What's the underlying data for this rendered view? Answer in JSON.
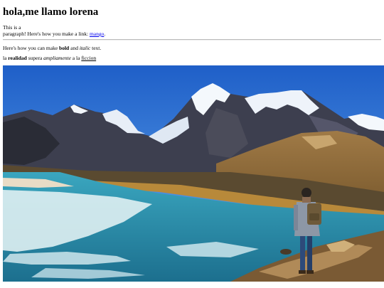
{
  "heading": "hola,me llamo lorena",
  "para1": {
    "line1": "This is a",
    "line2_text": "paragraph! Here's how you make a link: ",
    "link_text": "mango",
    "line2_end": "."
  },
  "para2": {
    "pre": "Here's how you can make ",
    "bold": "bold",
    "mid": " and ",
    "italic": "italic",
    "post": " text."
  },
  "para3": {
    "w1": "la ",
    "w2_bold": "realidad",
    "w3": " supera ",
    "w4_italic": "ampliamente",
    "w5": " a la ",
    "w6_underline": "ficcion"
  },
  "image": {
    "subject": "mountain-lake-hiker-photo"
  }
}
